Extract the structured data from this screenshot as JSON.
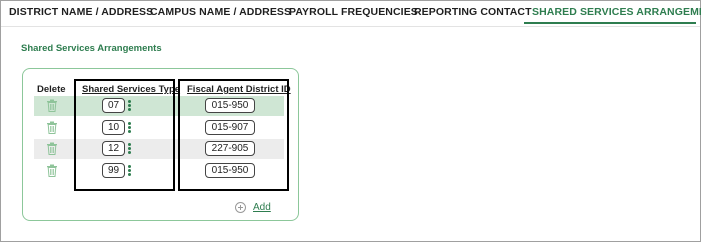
{
  "tabs": [
    {
      "label": "DISTRICT NAME / ADDRESS",
      "active": false
    },
    {
      "label": "CAMPUS NAME / ADDRESS",
      "active": false
    },
    {
      "label": "PAYROLL FREQUENCIES",
      "active": false
    },
    {
      "label": "REPORTING CONTACT",
      "active": false
    },
    {
      "label": "SHARED SERVICES ARRANGEMENT",
      "active": true
    }
  ],
  "section": {
    "title": "Shared Services Arrangements"
  },
  "table": {
    "headers": {
      "delete": "Delete",
      "type": "Shared Services Type",
      "fiscal": "Fiscal Agent District ID"
    },
    "rows": [
      {
        "type": "07",
        "fiscal": "015-950"
      },
      {
        "type": "10",
        "fiscal": "015-907"
      },
      {
        "type": "12",
        "fiscal": "227-905"
      },
      {
        "type": "99",
        "fiscal": "015-950"
      }
    ]
  },
  "add": {
    "label": "Add",
    "icon": "plus-circle-icon"
  },
  "colors": {
    "accent": "#2e7d4f",
    "highlight_row": "#cfe6d4",
    "alt_row": "#ececec",
    "panel_border": "#8cc79a"
  }
}
